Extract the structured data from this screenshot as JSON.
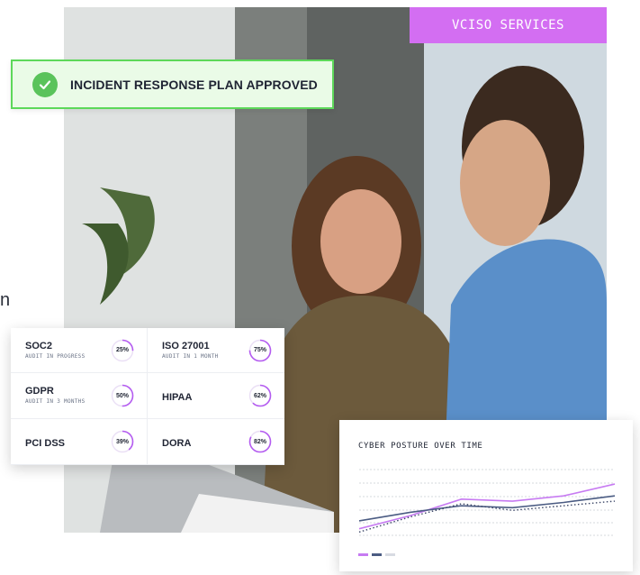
{
  "stray_letter": "n",
  "badge": {
    "label": "VCISO SERVICES",
    "color": "#d36ef2"
  },
  "banner": {
    "text": "INCIDENT RESPONSE PLAN APPROVED",
    "icon": "check-icon",
    "accent": "#5ac35b"
  },
  "compliance": [
    {
      "name": "SOC2",
      "status": "AUDIT IN PROGRESS",
      "percent": 25
    },
    {
      "name": "ISO 27001",
      "status": "AUDIT IN 1 MONTH",
      "percent": 75
    },
    {
      "name": "GDPR",
      "status": "AUDIT IN 3 MONTHS",
      "percent": 50
    },
    {
      "name": "HIPAA",
      "status": "",
      "percent": 62
    },
    {
      "name": "PCI DSS",
      "status": "",
      "percent": 39
    },
    {
      "name": "DORA",
      "status": "",
      "percent": 82
    }
  ],
  "ring_color": "#b45cf0",
  "chart_data": {
    "type": "line",
    "title": "CYBER POSTURE OVER TIME",
    "x": [
      0,
      1,
      2,
      3,
      4,
      5
    ],
    "ylim": [
      0,
      100
    ],
    "grid": true,
    "legend": "bottom-left",
    "series": [
      {
        "color": "#c77bf2",
        "style": "solid",
        "values": [
          10,
          30,
          55,
          52,
          60,
          78
        ]
      },
      {
        "color": "#4b5c83",
        "style": "solid",
        "values": [
          22,
          35,
          45,
          42,
          50,
          60
        ]
      },
      {
        "color": "#3a4566",
        "style": "dotted",
        "values": [
          5,
          28,
          48,
          38,
          45,
          52
        ]
      }
    ]
  }
}
